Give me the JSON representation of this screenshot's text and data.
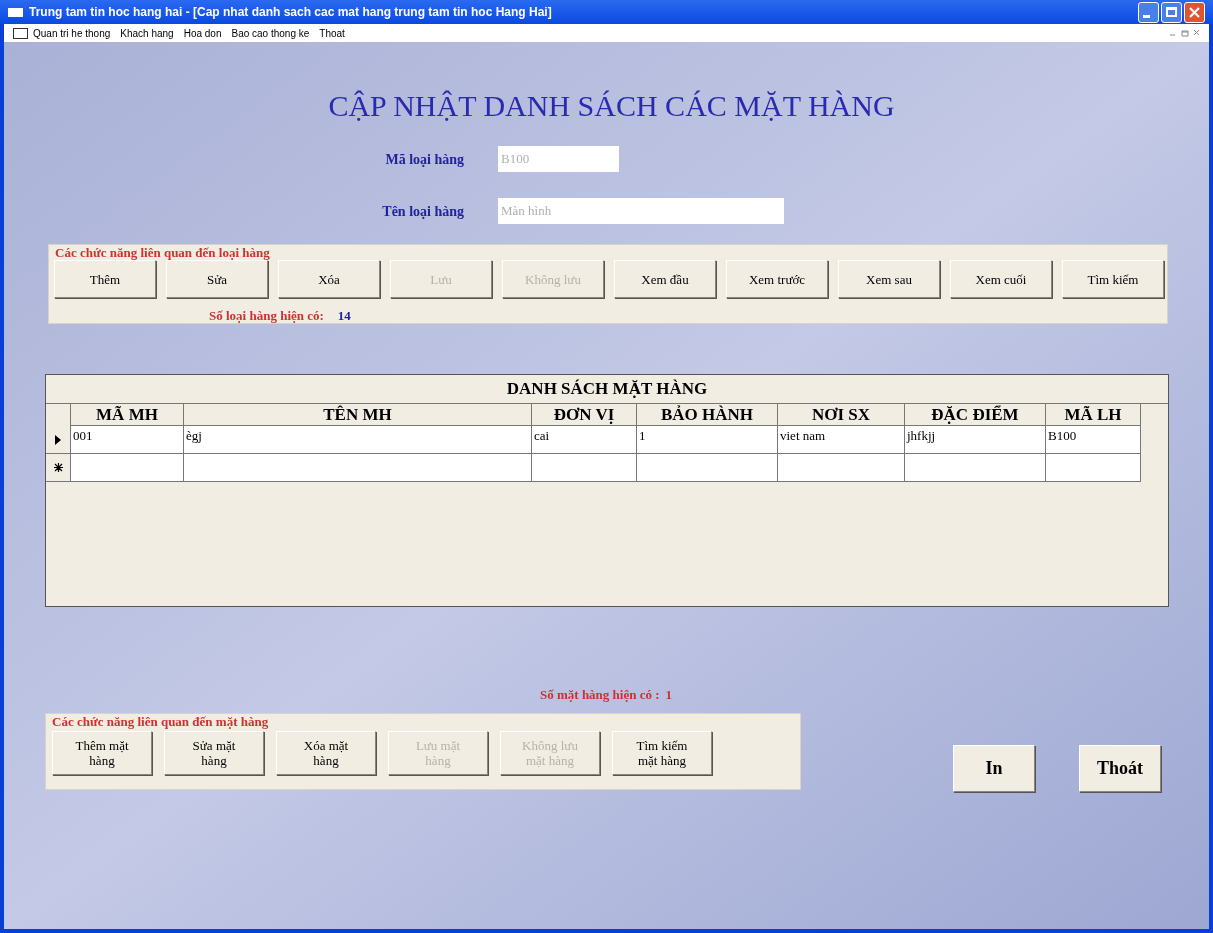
{
  "window": {
    "title": "Trung tam tin hoc hang hai - [Cap nhat danh sach cac mat hang trung tam tin hoc Hang Hai]"
  },
  "menu": [
    "Quan tri he thong",
    "Khach hang",
    "Hoa don",
    "Bao cao thong ke",
    "Thoat"
  ],
  "heading": "CẬP NHẬT DANH SÁCH CÁC MẶT HÀNG",
  "fields": [
    {
      "label": "Mã loại hàng",
      "value": "B100",
      "kind": "short"
    },
    {
      "label": "Tên loại hàng",
      "value": "Màn hình",
      "kind": "long"
    }
  ],
  "category_group": {
    "title": "Các chức năng liên quan đến loại hàng",
    "buttons": [
      {
        "label": "Thêm",
        "disabled": false
      },
      {
        "label": "Sửa",
        "disabled": false
      },
      {
        "label": "Xóa",
        "disabled": false
      },
      {
        "label": "Lưu",
        "disabled": true
      },
      {
        "label": "Không lưu",
        "disabled": true
      },
      {
        "label": "Xem đầu",
        "disabled": false
      },
      {
        "label": "Xem trước",
        "disabled": false
      },
      {
        "label": "Xem sau",
        "disabled": false
      },
      {
        "label": "Xem cuối",
        "disabled": false
      },
      {
        "label": "Tìm kiếm",
        "disabled": false
      }
    ],
    "count_label": "Số loại hàng hiện có:",
    "count": "14"
  },
  "table": {
    "title": "DANH SÁCH MẶT HÀNG",
    "columns": [
      "MÃ MH",
      "TÊN MH",
      "ĐƠN VỊ",
      "BẢO HÀNH",
      "NƠI SX",
      "ĐẶC ĐIỂM",
      "MÃ LH"
    ],
    "rows": [
      {
        "kind": "current",
        "cells": [
          "001",
          "ègj",
          "cai",
          "1",
          "viet nam",
          "jhfkjj",
          "B100"
        ]
      },
      {
        "kind": "new"
      }
    ]
  },
  "item_count": {
    "label": "Số mặt hàng hiện có :",
    "value": "1"
  },
  "item_group": {
    "title": "Các chức năng liên quan đến mặt hàng",
    "buttons": [
      {
        "label": "Thêm mặt hàng",
        "disabled": false
      },
      {
        "label": "Sửa mặt hàng",
        "disabled": false
      },
      {
        "label": "Xóa mặt hàng",
        "disabled": false
      },
      {
        "label": "Lưu mặt hàng",
        "disabled": true
      },
      {
        "label": "Không lưu mặt hàng",
        "disabled": true
      },
      {
        "label": "Tìm kiếm mặt hàng",
        "disabled": false
      }
    ]
  },
  "actions": [
    "In",
    "Thoát"
  ]
}
